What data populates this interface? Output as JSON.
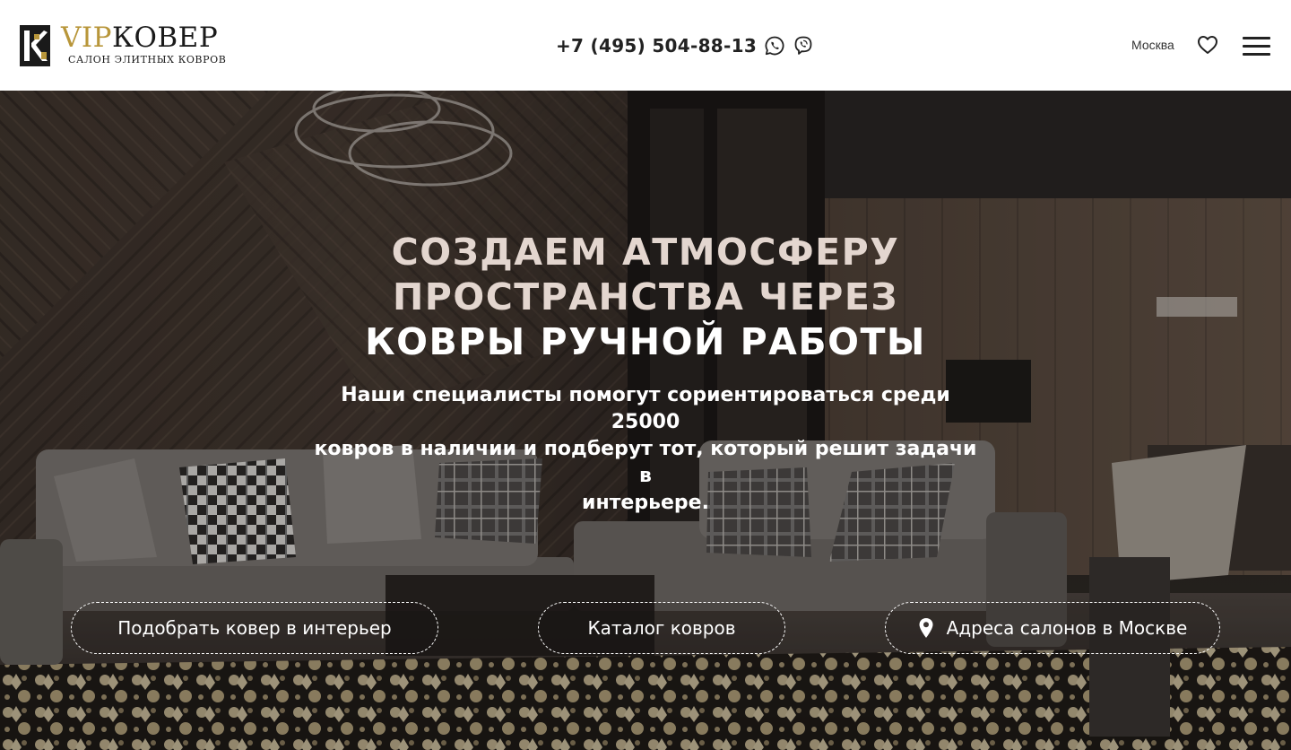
{
  "header": {
    "logo": {
      "brand_accent": "VIP",
      "brand_main": "КОВЕР",
      "tagline": "САЛОН ЭЛИТНЫХ КОВРОВ"
    },
    "phone": "+7 (495) 504-88-13",
    "messengers": [
      {
        "icon": "whatsapp-icon"
      },
      {
        "icon": "viber-icon"
      }
    ],
    "city": "Москва",
    "favorites_icon": "heart-icon",
    "menu_icon": "hamburger-menu-icon"
  },
  "hero": {
    "title_line1": "СОЗДАЕМ АТМОСФЕРУ",
    "title_line2": "ПРОСТРАНСТВА ЧЕРЕЗ",
    "title_line3": "КОВРЫ РУЧНОЙ РАБОТЫ",
    "subtitle_line1": "Наши специалисты помогут сориентироваться среди 25000",
    "subtitle_line2": "ковров в наличии и подберут тот, который решит задачи в",
    "subtitle_line3": "интерьере.",
    "buttons": [
      {
        "label": "Подобрать ковер в интерьер"
      },
      {
        "label": "Каталог ковров"
      },
      {
        "label": "Адреса салонов в Москве",
        "icon": "map-pin-icon"
      }
    ]
  },
  "colors": {
    "gold": "#b8963a",
    "title_light": "#e3d6cf",
    "white": "#ffffff",
    "dark": "#222222"
  }
}
